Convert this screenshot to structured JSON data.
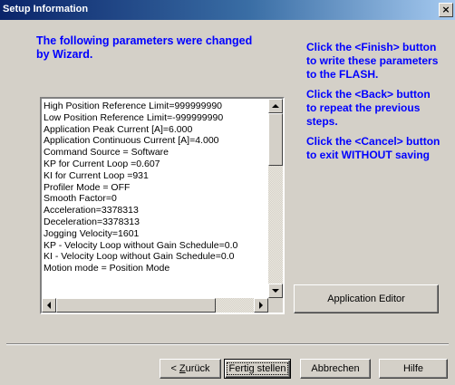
{
  "window": {
    "title": "Setup Information",
    "close_label": "×"
  },
  "heading": "The following parameters were changed by Wizard.",
  "parameters": [
    "High Position Reference Limit=999999990",
    "Low Position Reference Limit=-999999990",
    "Application Peak Current [A]=6.000",
    "Application Continuous  Current [A]=4.000",
    "Command Source = Software",
    "KP for Current Loop =0.607",
    "KI for Current Loop =931",
    "Profiler Mode = OFF",
    "Smooth Factor=0",
    "Acceleration=3378313",
    "Deceleration=3378313",
    "Jogging Velocity=1601",
    "KP - Velocity Loop without Gain Schedule=0.0",
    "KI - Velocity Loop without Gain Schedule=0.0",
    "Motion mode = Position Mode"
  ],
  "info": {
    "finish": "Click the <Finish> button to write these parameters to the FLASH.",
    "back": "Click the <Back> button to repeat the previous steps.",
    "cancel": "Click the <Cancel> button to exit WITHOUT saving"
  },
  "buttons": {
    "app_editor": "Application Editor",
    "back_prefix": "< ",
    "back_accel": "Z",
    "back_rest": "urück",
    "finish": "Fertig stellen",
    "cancel": "Abbrechen",
    "help": "Hilfe"
  },
  "colors": {
    "info_text": "#0000ff",
    "title_bar": "#0a246a",
    "face": "#d4d0c8"
  }
}
